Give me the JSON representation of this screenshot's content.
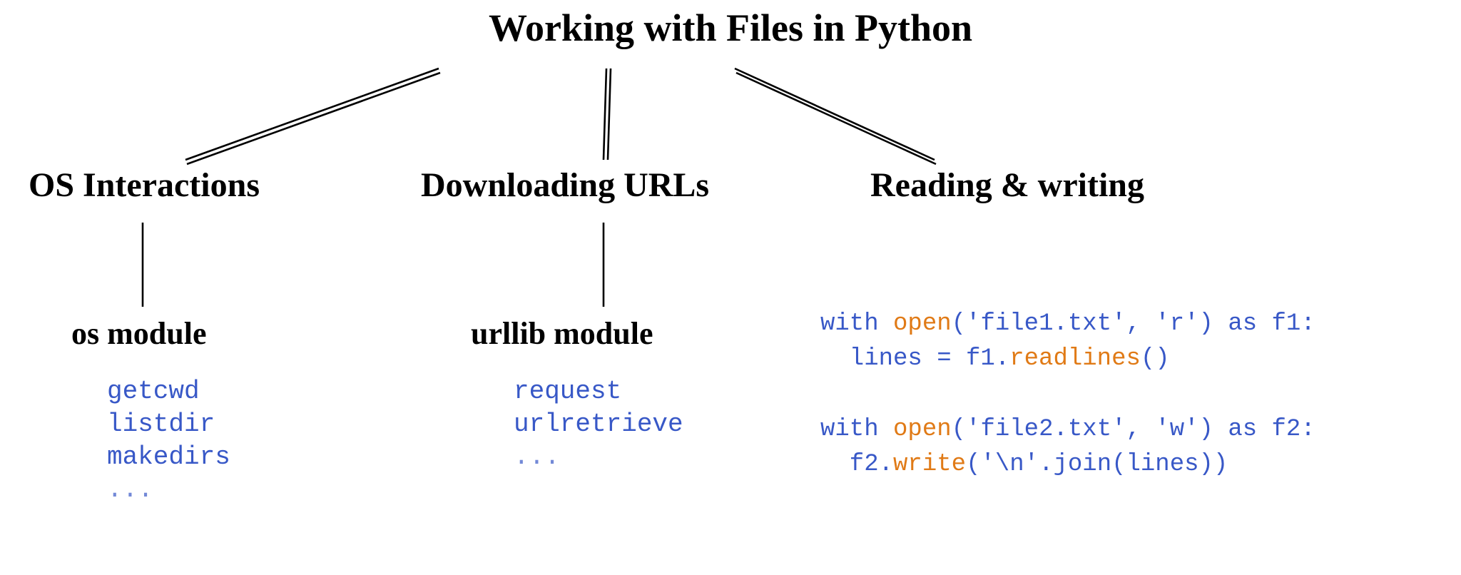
{
  "title": "Working with Files in Python",
  "branches": {
    "os": {
      "heading": "OS Interactions",
      "module": "os module",
      "items": [
        "getcwd",
        "listdir",
        "makedirs",
        "..."
      ]
    },
    "url": {
      "heading": "Downloading URLs",
      "module": "urllib module",
      "items": [
        "request",
        "urlretrieve",
        "..."
      ]
    },
    "rw": {
      "heading": "Reading & writing",
      "code": {
        "l1_with": "with ",
        "l1_open": "open",
        "l1_rest": "('file1.txt', 'r') as f1:",
        "l2_indent": "  lines = f1.",
        "l2_fn": "readlines",
        "l2_end": "()",
        "gap": "",
        "l3_with": "with ",
        "l3_open": "open",
        "l3_rest": "('file2.txt', 'w') as f2:",
        "l4_indent": "  f2.",
        "l4_fn": "write",
        "l4_end": "('\\n'.join(lines))"
      }
    }
  }
}
